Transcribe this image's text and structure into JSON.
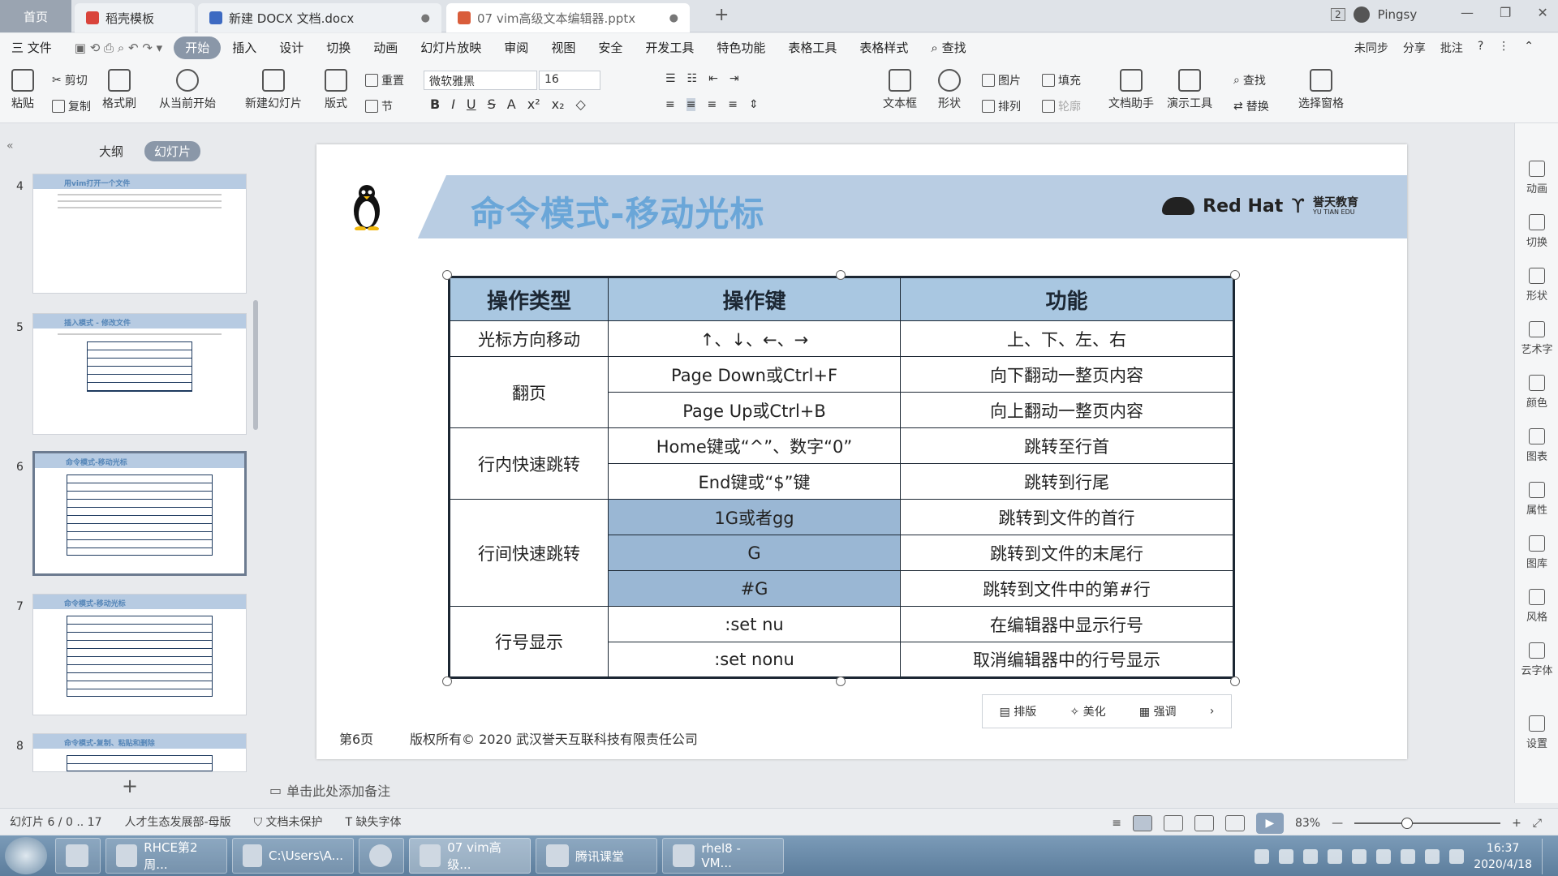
{
  "tabs": {
    "home": "首页",
    "items": [
      {
        "label": "稻壳模板",
        "icon": "daoke-icon",
        "color": "#d9443b"
      },
      {
        "label": "新建 DOCX 文档.docx",
        "icon": "word-icon",
        "color": "#3d6ac2"
      },
      {
        "label": "07 vim高级文本编辑器.pptx",
        "icon": "ppt-icon",
        "color": "#d95d3b"
      }
    ],
    "new_tab": "+",
    "count_badge": "2",
    "user": "Pingsy"
  },
  "menu": {
    "file": "三 文件",
    "items": [
      "开始",
      "插入",
      "设计",
      "切换",
      "动画",
      "幻灯片放映",
      "审阅",
      "视图",
      "安全",
      "开发工具",
      "特色功能",
      "表格工具",
      "表格样式"
    ],
    "active": "开始",
    "search": "查找",
    "right": [
      "未同步",
      "分享",
      "批注"
    ]
  },
  "ribbon": {
    "paste": "粘贴",
    "cut": "剪切",
    "copy": "复制",
    "format_painter": "格式刷",
    "from_current": "从当前开始",
    "new_slide": "新建幻灯片",
    "layout": "版式",
    "reset": "重置",
    "section": "节",
    "font": "微软雅黑",
    "size": "16",
    "textbox": "文本框",
    "shape": "形状",
    "picture": "图片",
    "arrange": "排列",
    "fill": "填充",
    "outline": "轮廓",
    "doc_assistant": "文档助手",
    "present_tools": "演示工具",
    "find": "查找",
    "replace": "替换",
    "select_pane": "选择窗格"
  },
  "sidebar": {
    "outline": "大纲",
    "slides": "幻灯片",
    "thumbs": [
      {
        "num": "4",
        "title": "用vim打开一个文件"
      },
      {
        "num": "5",
        "title": "插入模式 - 修改文件"
      },
      {
        "num": "6",
        "title": "命令模式-移动光标"
      },
      {
        "num": "7",
        "title": "命令模式-移动光标"
      },
      {
        "num": "8",
        "title": "命令模式-复制、粘贴和删除"
      }
    ]
  },
  "slide": {
    "title": "命令模式-移动光标",
    "brand": "Red Hat",
    "edu": "誉天教育",
    "edu_sub": "YU TIAN EDU",
    "headers": [
      "操作类型",
      "操作键",
      "功能"
    ],
    "rows": [
      {
        "type": "光标方向移动",
        "key": "↑、↓、←、→",
        "func": "上、下、左、右"
      },
      {
        "type": "翻页",
        "key": "Page Down或Ctrl+F",
        "func": "向下翻动一整页内容"
      },
      {
        "key": "Page Up或Ctrl+B",
        "func": "向上翻动一整页内容"
      },
      {
        "type": "行内快速跳转",
        "key": "Home键或“^”、数字“0”",
        "func": "跳转至行首"
      },
      {
        "key": "End键或“$”键",
        "func": "跳转到行尾"
      },
      {
        "type": "行间快速跳转",
        "key": "1G或者gg",
        "func": "跳转到文件的首行"
      },
      {
        "key": "G",
        "func": "跳转到文件的末尾行"
      },
      {
        "key": "#G",
        "func": "跳转到文件中的第#行"
      },
      {
        "type": "行号显示",
        "key": ":set nu",
        "func": "在编辑器中显示行号"
      },
      {
        "key": ":set nonu",
        "func": "取消编辑器中的行号显示"
      }
    ],
    "page": "第6页",
    "copyright": "版权所有© 2020 武汉誉天互联科技有限责任公司",
    "float_tools": [
      "排版",
      "美化",
      "强调"
    ]
  },
  "right_panel": [
    "动画",
    "切换",
    "形状",
    "艺术字",
    "颜色",
    "图表",
    "属性",
    "图库",
    "风格",
    "云字体",
    "设置"
  ],
  "notes_placeholder": "单击此处添加备注",
  "status": {
    "slide_pos": "幻灯片 6 / 0 .. 17",
    "theme": "人才生态发展部-母版",
    "protect": "文档未保护",
    "missing_font": "缺失字体",
    "zoom": "83%",
    "zoom_level": 0.36
  },
  "taskbar": {
    "items": [
      "RHCE第2周...",
      "C:\\Users\\A...",
      "",
      "07 vim高级...",
      "腾讯课堂",
      "rhel8 - VM..."
    ],
    "time": "16:37",
    "date": "2020/4/18"
  }
}
